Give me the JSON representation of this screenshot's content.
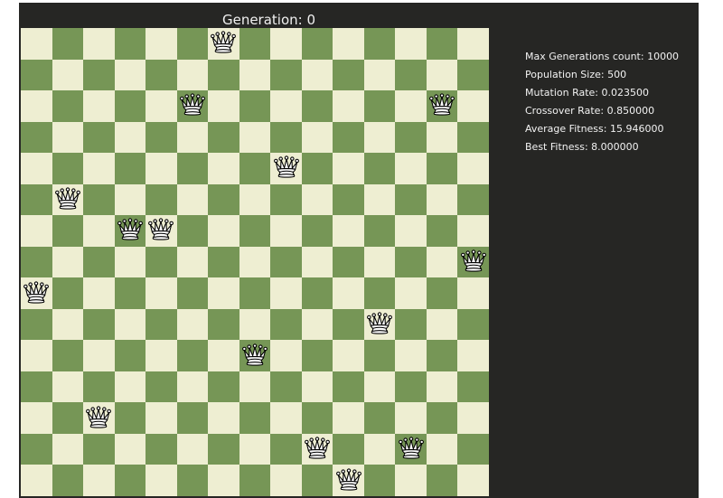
{
  "header": {
    "generation_text": "Generation: 0"
  },
  "board": {
    "size": 15,
    "light_color": "#eeeed2",
    "dark_color": "#769656",
    "queen_icon": "white-queen-icon",
    "queens": [
      {
        "row": 0,
        "col": 6
      },
      {
        "row": 2,
        "col": 5
      },
      {
        "row": 2,
        "col": 13
      },
      {
        "row": 4,
        "col": 8
      },
      {
        "row": 5,
        "col": 1
      },
      {
        "row": 6,
        "col": 3
      },
      {
        "row": 6,
        "col": 4
      },
      {
        "row": 7,
        "col": 14
      },
      {
        "row": 8,
        "col": 0
      },
      {
        "row": 9,
        "col": 11
      },
      {
        "row": 10,
        "col": 7
      },
      {
        "row": 12,
        "col": 2
      },
      {
        "row": 13,
        "col": 9
      },
      {
        "row": 13,
        "col": 12
      },
      {
        "row": 14,
        "col": 10
      }
    ]
  },
  "stats": {
    "max_generations": "Max Generations count: 10000",
    "population_size": "Population Size: 500",
    "mutation_rate": "Mutation Rate: 0.023500",
    "crossover_rate": "Crossover Rate: 0.850000",
    "average_fitness": "Average Fitness: 15.946000",
    "best_fitness": "Best Fitness: 8.000000"
  }
}
